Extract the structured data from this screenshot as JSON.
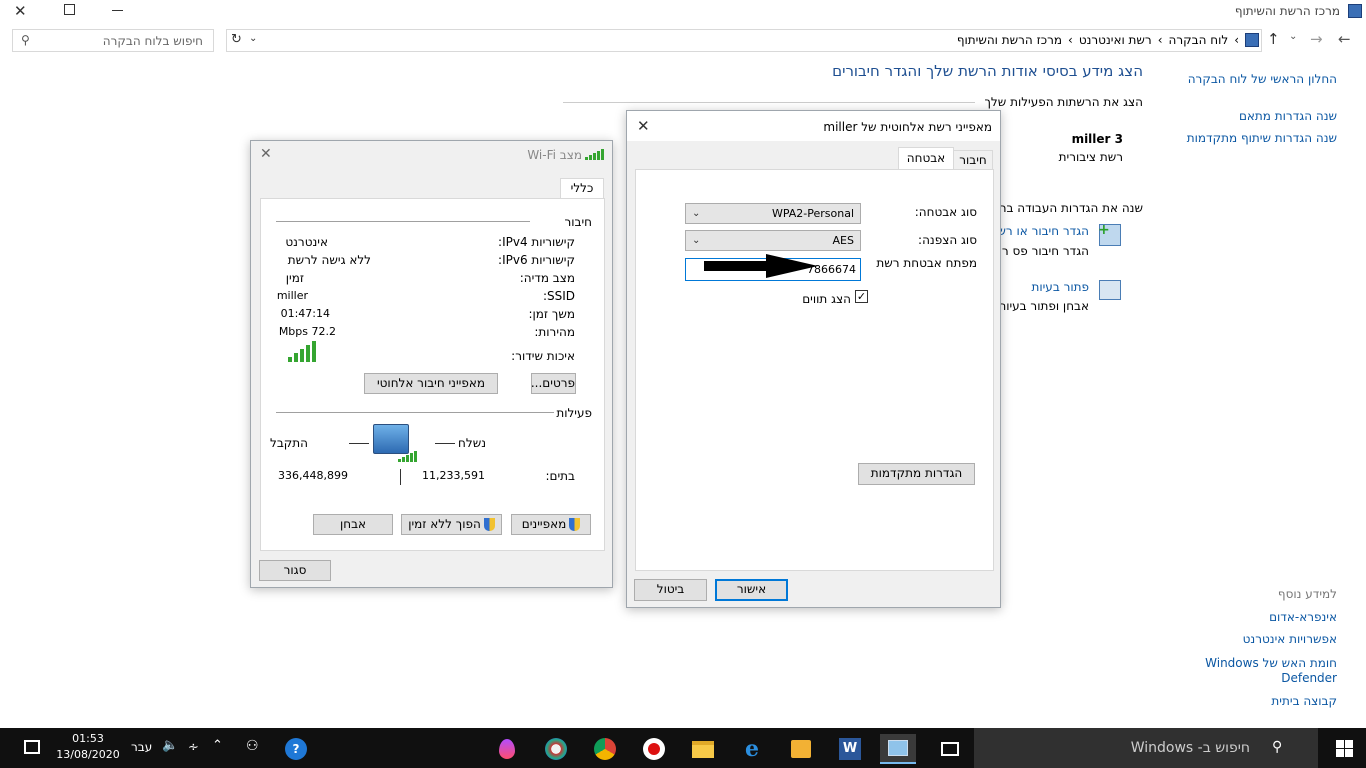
{
  "window": {
    "title": "מרכז הרשת והשיתוף"
  },
  "addressbar": {
    "crumbs": [
      "לוח הבקרה",
      "רשת ואינטרנט",
      "מרכז הרשת והשיתוף"
    ],
    "search_placeholder": "חיפוש בלוח הבקרה"
  },
  "sidebar": {
    "items": [
      "החלון הראשי של לוח הבקרה",
      "שנה הגדרות מתאם",
      "שנה הגדרות שיתוף מתקדמות"
    ],
    "see_also_title": "למידע נוסף",
    "see_also": [
      "אינפרא-אדום",
      "אפשרויות אינטרנט",
      "חומת האש של Windows Defender",
      "קבוצה ביתית"
    ]
  },
  "main": {
    "heading": "הצג מידע בסיסי אודות הרשת שלך והגדר חיבורים",
    "active_networks_label": "הצג את הרשתות הפעילות שלך",
    "network_name": "miller  3",
    "network_type": "רשת ציבורית",
    "change_settings_label": "שנה את הגדרות העבודה ברשת",
    "setup_link": "הגדר חיבור או רשת",
    "setup_desc": "הגדר חיבור פס רחב",
    "troubleshoot_link": "פתור בעיות",
    "troubleshoot_desc": "אבחן ופתור בעיות"
  },
  "wifi_status": {
    "title": "מצב Wi-Fi",
    "tab": "כללי",
    "connection_label": "חיבור",
    "rows": [
      {
        "label": "קישוריות IPv4:",
        "value": "אינטרנט"
      },
      {
        "label": "קישוריות IPv6:",
        "value": "ללא גישה לרשת"
      },
      {
        "label": "מצב מדיה:",
        "value": "זמין"
      },
      {
        "label": "SSID:",
        "value": "miller"
      },
      {
        "label": "משך זמן:",
        "value": "01:47:14"
      },
      {
        "label": "מהירות:",
        "value": "72.2 Mbps"
      }
    ],
    "signal_label": "איכות שידור:",
    "details_btn": "פרטים...",
    "wireless_props_btn": "מאפייני חיבור אלחוטי",
    "activity_label": "פעילות",
    "sent_label": "נשלח",
    "received_label": "התקבל",
    "bytes_label": "בתים:",
    "bytes_sent": "11,233,591",
    "bytes_received": "336,448,899",
    "properties_btn": "מאפיינים",
    "disable_btn": "הפוך ללא זמין",
    "diagnose_btn": "אבחן",
    "close_btn": "סגור"
  },
  "wireless_props": {
    "title": "מאפייני רשת אלחוטית של miller",
    "tab_connection": "חיבור",
    "tab_security": "אבטחה",
    "security_type_label": "סוג אבטחה:",
    "security_type_value": "WPA2-Personal",
    "encryption_type_label": "סוג הצפנה:",
    "encryption_type_value": "AES",
    "key_label": "מפתח אבטחת רשת",
    "key_value": "7866674",
    "show_chars_label": "הצג תווים",
    "show_chars_checked": true,
    "advanced_btn": "הגדרות מתקדמות",
    "ok_btn": "אישור",
    "cancel_btn": "ביטול"
  },
  "taskbar": {
    "search_placeholder": "חיפוש ב- Windows",
    "time": "01:53",
    "date": "13/08/2020",
    "language": "עבר"
  },
  "colors": {
    "link": "#0b57a3",
    "accent": "#0078d7",
    "taskbar": "#101010",
    "signal": "#35a531"
  }
}
